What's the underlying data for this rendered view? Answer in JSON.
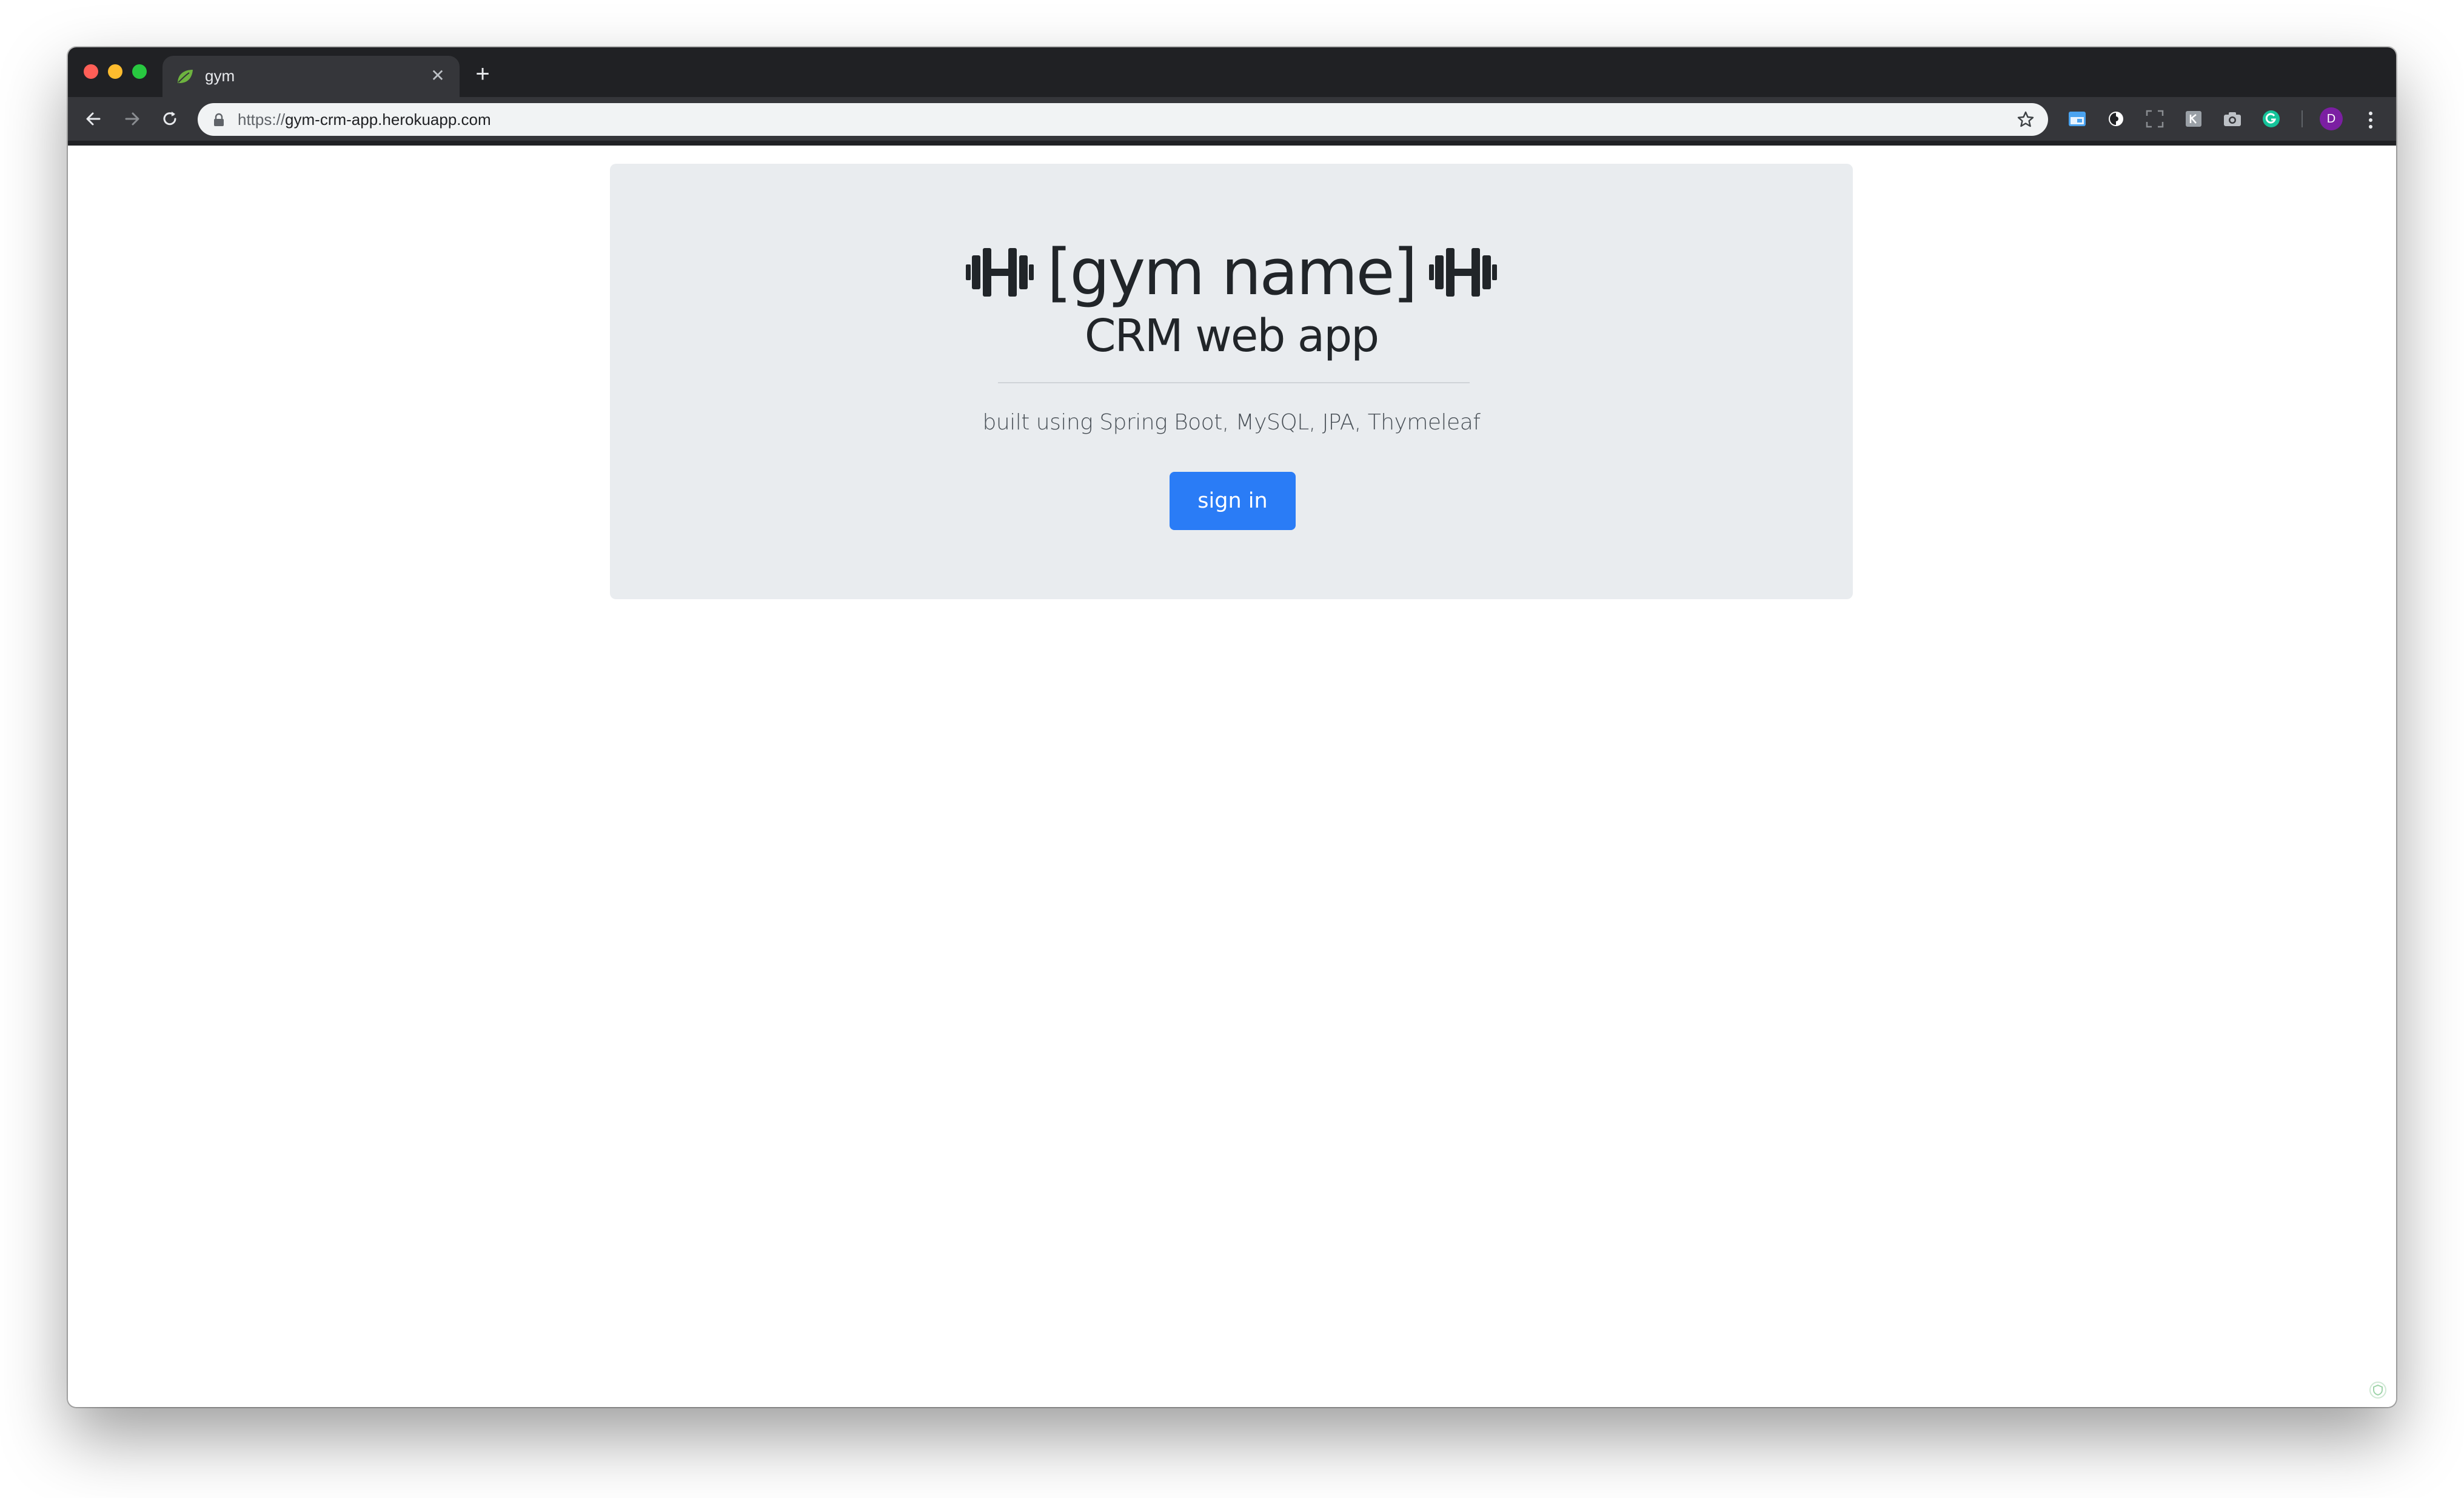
{
  "browser": {
    "tab": {
      "title": "gym",
      "favicon": "spring-leaf-icon",
      "close_glyph": "✕"
    },
    "new_tab_glyph": "+",
    "url": {
      "scheme": "https://",
      "host": "gym-crm-app.herokuapp.com"
    },
    "profile_initial": "D",
    "extensions": [
      "calendar-icon",
      "circle-half-icon",
      "screenshot-frame-icon",
      "extension-badge-icon",
      "camera-icon",
      "grammarly-icon"
    ]
  },
  "page": {
    "title": "[gym name]",
    "subtitle": "CRM web app",
    "lead": "built using Spring Boot, MySQL, JPA, Thymeleaf",
    "signin_label": "sign in"
  },
  "colors": {
    "primary_button": "#2a7cf6",
    "jumbotron_bg": "#e9ecef",
    "browser_frame": "#202124",
    "toolbar": "#35363a"
  }
}
